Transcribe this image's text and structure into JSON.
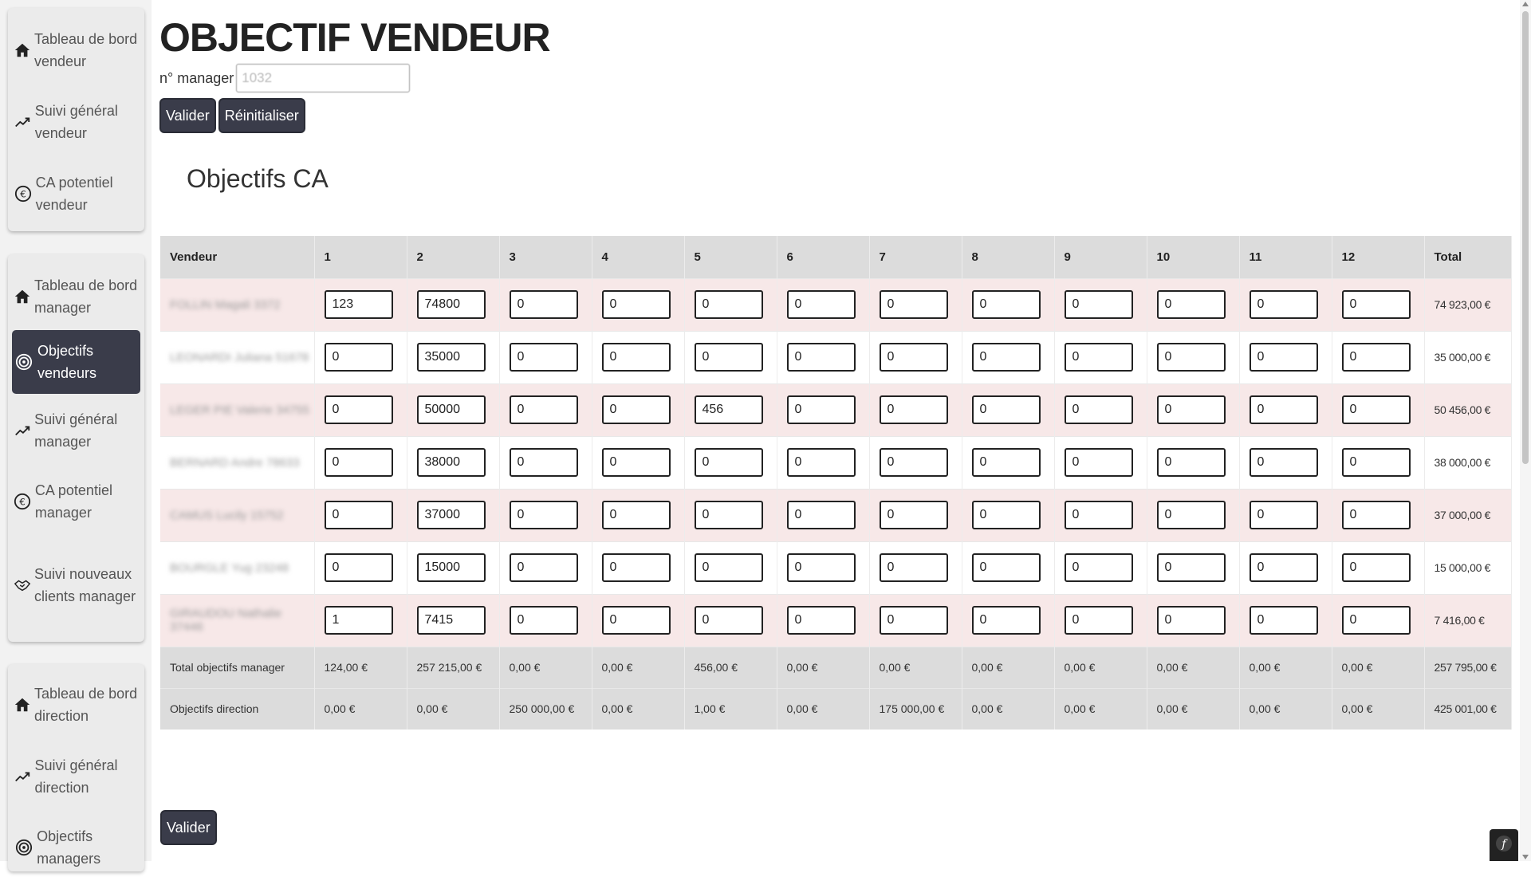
{
  "sidebar": {
    "groups": [
      {
        "items": [
          {
            "label": "Tableau de bord vendeur",
            "icon": "home-icon"
          },
          {
            "label": "Suivi général vendeur",
            "icon": "trend-up-icon"
          },
          {
            "label": "CA potentiel vendeur",
            "icon": "euro-icon"
          }
        ]
      },
      {
        "items": [
          {
            "label": "Tableau de bord manager",
            "icon": "home-icon"
          },
          {
            "label": "Objectifs vendeurs",
            "icon": "target-icon",
            "active": true
          },
          {
            "label": "Suivi général manager",
            "icon": "trend-up-icon"
          },
          {
            "label": "CA potentiel manager",
            "icon": "euro-icon"
          },
          {
            "label": "Suivi nouveaux clients manager",
            "icon": "handshake-icon"
          }
        ]
      },
      {
        "items": [
          {
            "label": "Tableau de bord direction",
            "icon": "home-icon"
          },
          {
            "label": "Suivi général direction",
            "icon": "trend-up-icon"
          },
          {
            "label": "Objectifs managers",
            "icon": "target-icon"
          }
        ]
      }
    ]
  },
  "page": {
    "title": "OBJECTIF VENDEUR",
    "manager_label": "n° manager",
    "manager_value": "1032",
    "validate_label": "Valider",
    "reset_label": "Réinitialiser",
    "section_title": "Objectifs CA",
    "bottom_validate_label": "Valider"
  },
  "table": {
    "headers": [
      "Vendeur",
      "1",
      "2",
      "3",
      "4",
      "5",
      "6",
      "7",
      "8",
      "9",
      "10",
      "11",
      "12",
      "Total"
    ],
    "rows": [
      {
        "vendor": "FOLLIN Magali 3372",
        "values": [
          "123",
          "74800",
          "0",
          "0",
          "0",
          "0",
          "0",
          "0",
          "0",
          "0",
          "0",
          "0"
        ],
        "total": "74 923,00 €"
      },
      {
        "vendor": "LEONARDI Juliana 51678",
        "values": [
          "0",
          "35000",
          "0",
          "0",
          "0",
          "0",
          "0",
          "0",
          "0",
          "0",
          "0",
          "0"
        ],
        "total": "35 000,00 €"
      },
      {
        "vendor": "LEGER PIE Valerie 34755",
        "values": [
          "0",
          "50000",
          "0",
          "0",
          "456",
          "0",
          "0",
          "0",
          "0",
          "0",
          "0",
          "0"
        ],
        "total": "50 456,00 €"
      },
      {
        "vendor": "BERNARD Andre 78633",
        "values": [
          "0",
          "38000",
          "0",
          "0",
          "0",
          "0",
          "0",
          "0",
          "0",
          "0",
          "0",
          "0"
        ],
        "total": "38 000,00 €"
      },
      {
        "vendor": "CAMUS Lucily 15752",
        "values": [
          "0",
          "37000",
          "0",
          "0",
          "0",
          "0",
          "0",
          "0",
          "0",
          "0",
          "0",
          "0"
        ],
        "total": "37 000,00 €"
      },
      {
        "vendor": "BOURGLE Yug 23248",
        "values": [
          "0",
          "15000",
          "0",
          "0",
          "0",
          "0",
          "0",
          "0",
          "0",
          "0",
          "0",
          "0"
        ],
        "total": "15 000,00 €"
      },
      {
        "vendor": "GIRAUDOU Nathalie 37446",
        "values": [
          "1",
          "7415",
          "0",
          "0",
          "0",
          "0",
          "0",
          "0",
          "0",
          "0",
          "0",
          "0"
        ],
        "total": "7 416,00 €"
      }
    ],
    "summary_rows": [
      {
        "label": "Total objectifs manager",
        "values": [
          "124,00 €",
          "257 215,00 €",
          "0,00 €",
          "0,00 €",
          "456,00 €",
          "0,00 €",
          "0,00 €",
          "0,00 €",
          "0,00 €",
          "0,00 €",
          "0,00 €",
          "0,00 €"
        ],
        "total": "257 795,00 €"
      },
      {
        "label": "Objectifs direction",
        "values": [
          "0,00 €",
          "0,00 €",
          "250 000,00 €",
          "0,00 €",
          "1,00 €",
          "0,00 €",
          "175 000,00 €",
          "0,00 €",
          "0,00 €",
          "0,00 €",
          "0,00 €",
          "0,00 €"
        ],
        "total": "425 001,00 €"
      }
    ]
  },
  "colors": {
    "primary_button": "#3a3c4a",
    "odd_row": "#f7e8e8",
    "header_bg": "#dcdcdc"
  }
}
